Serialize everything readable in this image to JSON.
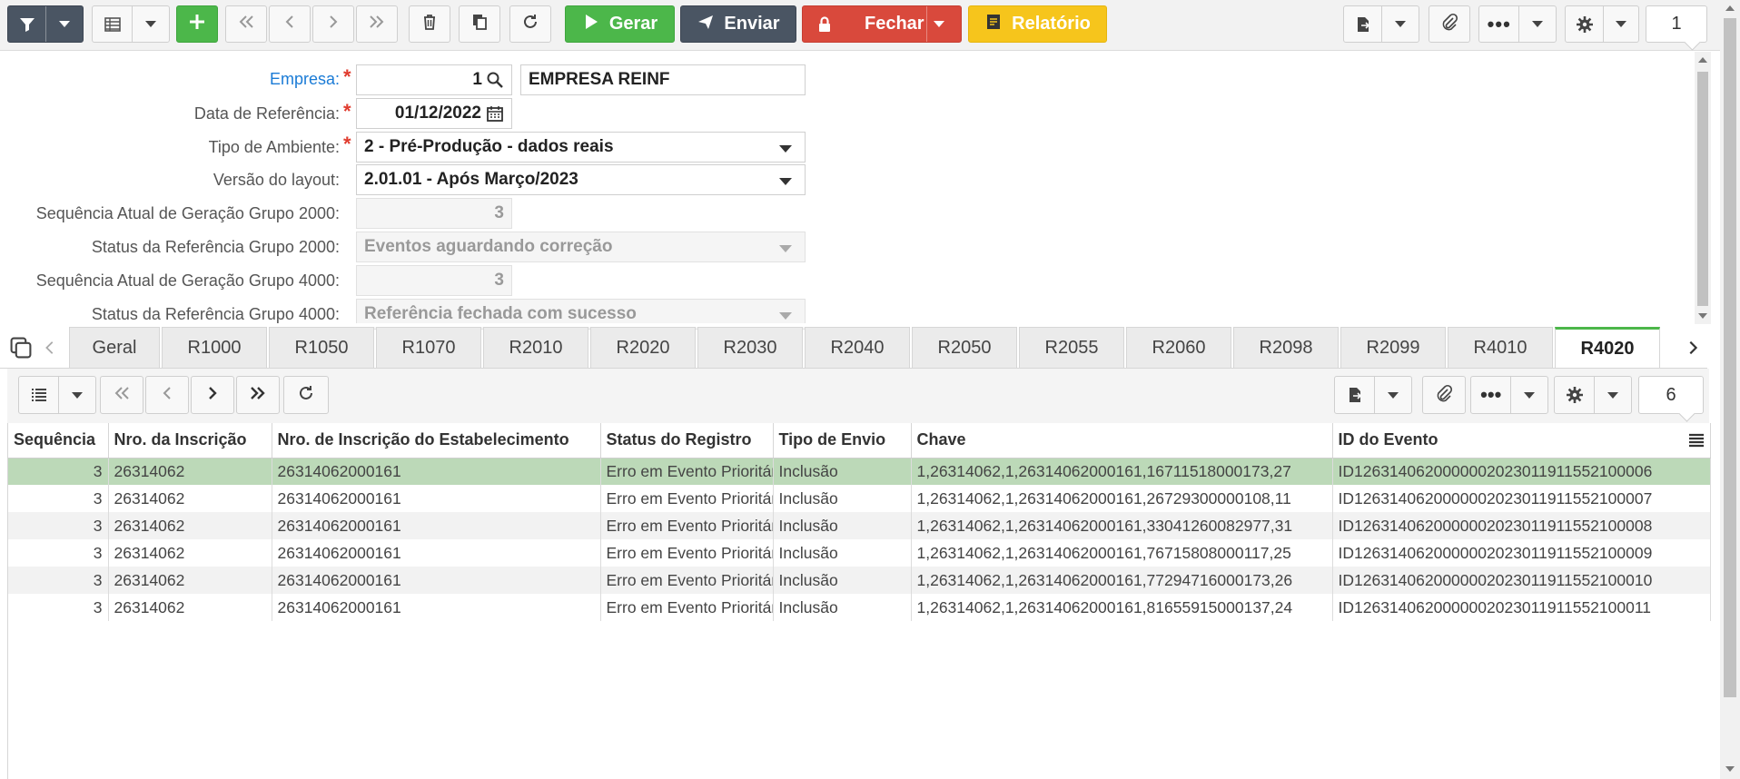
{
  "toolbar": {
    "gerar_label": "Gerar",
    "enviar_label": "Enviar",
    "fechar_label": "Fechar",
    "relatorio_label": "Relatório",
    "page_value": "1"
  },
  "form": {
    "empresa": {
      "label": "Empresa:",
      "code": "1",
      "name": "EMPRESA REINF"
    },
    "data_referencia": {
      "label": "Data de Referência:",
      "value": "01/12/2022"
    },
    "tipo_ambiente": {
      "label": "Tipo de Ambiente:",
      "value": "2 - Pré-Produção - dados reais"
    },
    "versao_layout": {
      "label": "Versão do layout:",
      "value": "2.01.01 - Após Março/2023"
    },
    "seq_2000": {
      "label": "Sequência Atual de Geração Grupo 2000:",
      "value": "3"
    },
    "status_2000": {
      "label": "Status da Referência Grupo 2000:",
      "value": "Eventos aguardando correção"
    },
    "seq_4000": {
      "label": "Sequência Atual de Geração Grupo 4000:",
      "value": "3"
    },
    "status_4000": {
      "label": "Status da Referência Grupo 4000:",
      "value": "Referência fechada com sucesso"
    }
  },
  "tabs": [
    "Geral",
    "R1000",
    "R1050",
    "R1070",
    "R2010",
    "R2020",
    "R2030",
    "R2040",
    "R2050",
    "R2055",
    "R2060",
    "R2098",
    "R2099",
    "R4010",
    "R4020"
  ],
  "active_tab": "R4020",
  "grid": {
    "page_value": "6",
    "columns": [
      "Sequência",
      "Nro. da Inscrição",
      "Nro. de Inscrição do Estabelecimento",
      "Status do Registro",
      "Tipo de Envio",
      "Chave",
      "ID do Evento"
    ],
    "rows": [
      [
        "3",
        "26314062",
        "26314062000161",
        "Erro em Evento Prioritário",
        "Inclusão",
        "1,26314062,1,26314062000161,16711518000173,27",
        "ID1263140620000002023011911552100006"
      ],
      [
        "3",
        "26314062",
        "26314062000161",
        "Erro em Evento Prioritário",
        "Inclusão",
        "1,26314062,1,26314062000161,26729300000108,11",
        "ID1263140620000002023011911552100007"
      ],
      [
        "3",
        "26314062",
        "26314062000161",
        "Erro em Evento Prioritário",
        "Inclusão",
        "1,26314062,1,26314062000161,33041260082977,31",
        "ID1263140620000002023011911552100008"
      ],
      [
        "3",
        "26314062",
        "26314062000161",
        "Erro em Evento Prioritário",
        "Inclusão",
        "1,26314062,1,26314062000161,76715808000117,25",
        "ID1263140620000002023011911552100009"
      ],
      [
        "3",
        "26314062",
        "26314062000161",
        "Erro em Evento Prioritário",
        "Inclusão",
        "1,26314062,1,26314062000161,77294716000173,26",
        "ID1263140620000002023011911552100010"
      ],
      [
        "3",
        "26314062",
        "26314062000161",
        "Erro em Evento Prioritário",
        "Inclusão",
        "1,26314062,1,26314062000161,81655915000137,24",
        "ID1263140620000002023011911552100011"
      ]
    ]
  },
  "colors": {
    "green": "#4cb74a",
    "dark": "#4a5563",
    "red": "#d9493c",
    "yellow": "#f6c51c",
    "link": "#1a7bd6",
    "selected_row": "#bcd9b8"
  }
}
